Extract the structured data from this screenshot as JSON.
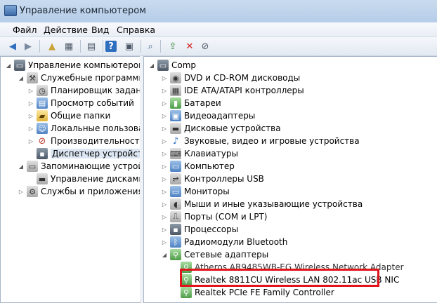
{
  "window": {
    "title": "Управление компьютером"
  },
  "menu": [
    {
      "label": "Файл"
    },
    {
      "label": "Действие"
    },
    {
      "label": "Вид"
    },
    {
      "label": "Справка"
    }
  ],
  "toolbar": {
    "icons": [
      "back-icon",
      "forward-icon",
      "up-folder-icon",
      "show-hide-tree-icon",
      "properties-icon",
      "help-icon",
      "action-pane-icon",
      "scan-hardware-icon",
      "update-driver-icon",
      "uninstall-device-icon",
      "disable-device-icon"
    ]
  },
  "left_tree": {
    "items": [
      {
        "label": "Управление компьютером (л"
      },
      {
        "label": "Служебные программы"
      },
      {
        "label": "Планировщик заданий"
      },
      {
        "label": "Просмотр событий"
      },
      {
        "label": "Общие папки"
      },
      {
        "label": "Локальные пользовате"
      },
      {
        "label": "Производительность"
      },
      {
        "label": "Диспетчер устройств"
      },
      {
        "label": "Запоминающие устройст"
      },
      {
        "label": "Управление дисками"
      },
      {
        "label": "Службы и приложения"
      }
    ],
    "selected": "Диспетчер устройств"
  },
  "device_tree": {
    "root": "Comp",
    "categories": [
      {
        "label": "DVD и CD-ROM дисководы"
      },
      {
        "label": "IDE ATA/ATAPI контроллеры"
      },
      {
        "label": "Батареи"
      },
      {
        "label": "Видеоадаптеры"
      },
      {
        "label": "Дисковые устройства"
      },
      {
        "label": "Звуковые, видео и игровые устройства"
      },
      {
        "label": "Клавиатуры"
      },
      {
        "label": "Компьютер"
      },
      {
        "label": "Контроллеры USB"
      },
      {
        "label": "Мониторы"
      },
      {
        "label": "Мыши и иные указывающие устройства"
      },
      {
        "label": "Порты (COM и LPT)"
      },
      {
        "label": "Процессоры"
      },
      {
        "label": "Радиомодули Bluetooth"
      },
      {
        "label": "Сетевые адаптеры"
      }
    ],
    "network_adapters": [
      {
        "label": "Atheros AR9485WB-EG Wireless Network Adapter"
      },
      {
        "label": "Realtek 8811CU Wireless LAN 802.11ac USB NIC"
      },
      {
        "label": "Realtek PCIe FE Family Controller"
      }
    ]
  },
  "colors": {
    "highlight_box": "#e0141b",
    "selection": "#dde7f3"
  }
}
